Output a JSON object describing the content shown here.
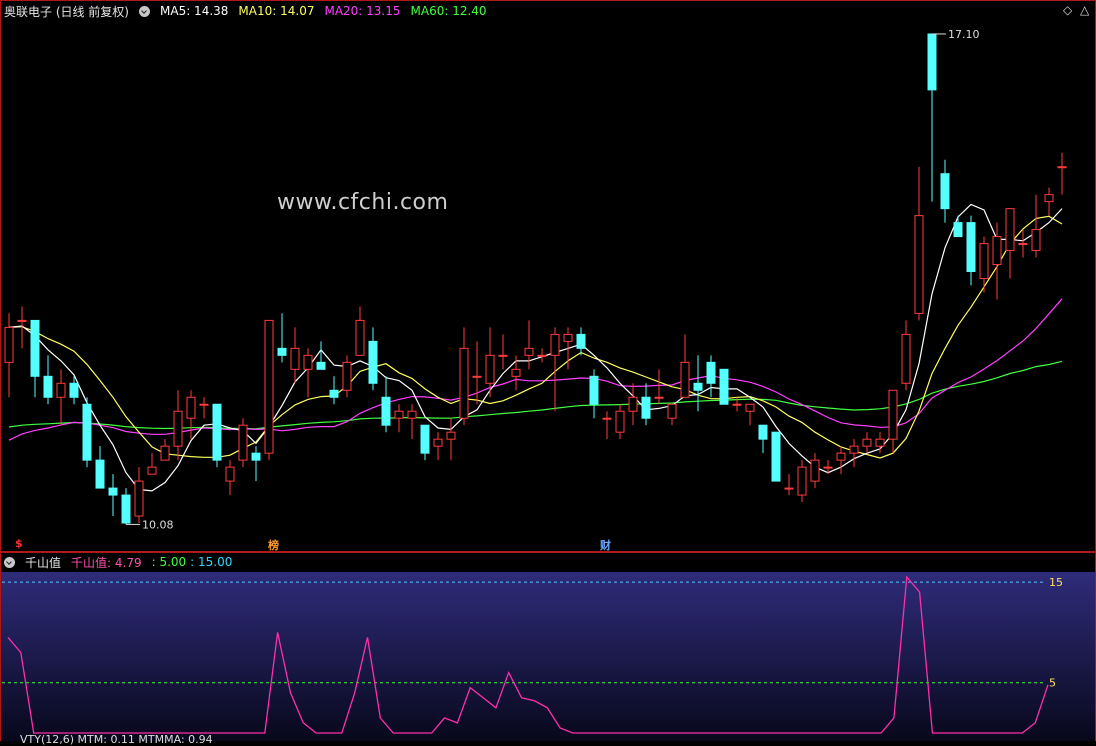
{
  "header": {
    "title": "奥联电子 (日线 前复权)",
    "ma5": "MA5: 14.38",
    "ma10": "MA10: 14.07",
    "ma20": "MA20: 13.15",
    "ma60": "MA60: 12.40",
    "colors": {
      "ma5": "#ffffff",
      "ma10": "#ffff60",
      "ma20": "#ff40ff",
      "ma60": "#40ff40"
    }
  },
  "watermark": "www.cfchi.com",
  "badges": {
    "s_mark": "$",
    "bang": "榜",
    "cai": "财"
  },
  "price_labels": {
    "high": "17.10",
    "low": "10.08"
  },
  "indicator_header": {
    "name": "千山值",
    "value": "千山值: 4.79",
    "level_low": ": 5.00",
    "level_high": ": 15.00"
  },
  "bottom_legend": "VTY(12,6)  MTM: 0.11  MTMMA: 0.94",
  "chart_data": [
    {
      "type": "candlestick",
      "title": "奥联电子 (日线 前复权)",
      "ohlc": [
        [
          12.4,
          13.1,
          11.9,
          12.9
        ],
        [
          13.0,
          13.2,
          12.6,
          13.0
        ],
        [
          13.0,
          13.0,
          11.9,
          12.2
        ],
        [
          12.2,
          12.5,
          11.8,
          11.9
        ],
        [
          11.9,
          12.3,
          11.5,
          12.1
        ],
        [
          12.1,
          12.2,
          11.8,
          11.9
        ],
        [
          11.8,
          11.9,
          10.9,
          11.0
        ],
        [
          11.0,
          11.2,
          10.6,
          10.6
        ],
        [
          10.6,
          10.8,
          10.2,
          10.5
        ],
        [
          10.5,
          10.6,
          10.08,
          10.1
        ],
        [
          10.2,
          10.9,
          10.1,
          10.7
        ],
        [
          10.8,
          11.1,
          10.8,
          10.9
        ],
        [
          11.0,
          11.3,
          11.0,
          11.2
        ],
        [
          11.2,
          12.0,
          11.0,
          11.7
        ],
        [
          11.6,
          12.0,
          11.3,
          11.9
        ],
        [
          11.8,
          11.9,
          11.6,
          11.8
        ],
        [
          11.8,
          11.8,
          10.9,
          11.0
        ],
        [
          10.7,
          11.0,
          10.5,
          10.9
        ],
        [
          11.0,
          11.6,
          10.9,
          11.5
        ],
        [
          11.1,
          11.2,
          10.7,
          11.0
        ],
        [
          11.1,
          13.0,
          11.0,
          13.0
        ],
        [
          12.6,
          13.1,
          12.4,
          12.5
        ],
        [
          12.3,
          12.9,
          12.1,
          12.6
        ],
        [
          12.3,
          12.6,
          11.9,
          12.5
        ],
        [
          12.4,
          12.7,
          12.3,
          12.3
        ],
        [
          12.0,
          12.2,
          11.8,
          11.9
        ],
        [
          12.0,
          12.5,
          11.9,
          12.4
        ],
        [
          12.5,
          13.2,
          12.5,
          13.0
        ],
        [
          12.7,
          12.9,
          12.0,
          12.1
        ],
        [
          11.9,
          12.2,
          11.4,
          11.5
        ],
        [
          11.6,
          11.8,
          11.4,
          11.7
        ],
        [
          11.6,
          11.8,
          11.3,
          11.7
        ],
        [
          11.5,
          11.5,
          11.0,
          11.1
        ],
        [
          11.2,
          11.4,
          11.0,
          11.3
        ],
        [
          11.3,
          11.6,
          11.0,
          11.4
        ],
        [
          11.6,
          12.9,
          11.5,
          12.6
        ],
        [
          12.2,
          12.7,
          11.8,
          12.2
        ],
        [
          12.1,
          12.9,
          11.9,
          12.5
        ],
        [
          12.5,
          12.8,
          12.3,
          12.5
        ],
        [
          12.2,
          12.5,
          12.0,
          12.3
        ],
        [
          12.5,
          13.0,
          12.3,
          12.6
        ],
        [
          12.5,
          12.6,
          12.4,
          12.5
        ],
        [
          12.5,
          12.9,
          11.7,
          12.8
        ],
        [
          12.7,
          12.9,
          12.3,
          12.8
        ],
        [
          12.8,
          12.9,
          12.5,
          12.6
        ],
        [
          12.2,
          12.3,
          11.6,
          11.8
        ],
        [
          11.6,
          11.7,
          11.3,
          11.6
        ],
        [
          11.4,
          11.8,
          11.3,
          11.7
        ],
        [
          11.7,
          12.1,
          11.5,
          11.9
        ],
        [
          11.9,
          12.1,
          11.5,
          11.6
        ],
        [
          11.9,
          12.3,
          11.8,
          11.9
        ],
        [
          11.6,
          11.8,
          11.5,
          11.8
        ],
        [
          11.9,
          12.8,
          11.9,
          12.4
        ],
        [
          12.1,
          12.5,
          11.7,
          12.0
        ],
        [
          12.4,
          12.5,
          11.9,
          12.1
        ],
        [
          12.3,
          12.3,
          11.8,
          11.8
        ],
        [
          11.8,
          11.9,
          11.7,
          11.8
        ],
        [
          11.7,
          11.8,
          11.5,
          11.8
        ],
        [
          11.5,
          11.5,
          11.1,
          11.3
        ],
        [
          11.4,
          11.4,
          10.7,
          10.7
        ],
        [
          10.6,
          10.8,
          10.5,
          10.6
        ],
        [
          10.5,
          11.0,
          10.4,
          10.9
        ],
        [
          10.7,
          11.1,
          10.6,
          11.0
        ],
        [
          10.9,
          11.0,
          10.8,
          10.9
        ],
        [
          11.0,
          11.2,
          10.8,
          11.1
        ],
        [
          11.1,
          11.3,
          10.9,
          11.2
        ],
        [
          11.2,
          11.4,
          11.1,
          11.3
        ],
        [
          11.2,
          11.4,
          11.1,
          11.3
        ],
        [
          11.3,
          12.0,
          11.1,
          12.0
        ],
        [
          12.1,
          13.0,
          12.0,
          12.8
        ],
        [
          13.1,
          15.2,
          13.0,
          14.5
        ],
        [
          17.1,
          17.1,
          14.7,
          16.3
        ],
        [
          15.1,
          15.3,
          14.4,
          14.6
        ],
        [
          14.4,
          14.5,
          14.2,
          14.2
        ],
        [
          14.4,
          14.5,
          13.5,
          13.7
        ],
        [
          13.6,
          14.2,
          13.4,
          14.1
        ],
        [
          13.8,
          14.4,
          13.3,
          14.2
        ],
        [
          14.0,
          14.6,
          13.6,
          14.6
        ],
        [
          14.1,
          14.3,
          13.9,
          14.1
        ],
        [
          14.0,
          14.8,
          13.9,
          14.3
        ],
        [
          14.7,
          14.9,
          14.5,
          14.8
        ],
        [
          15.2,
          15.4,
          14.8,
          15.2
        ]
      ],
      "ma_lines": [
        "MA5",
        "MA10",
        "MA20",
        "MA60"
      ],
      "annotations": {
        "high": 17.1,
        "low": 10.08
      }
    },
    {
      "type": "line",
      "title": "千山值",
      "series": [
        {
          "name": "千山值",
          "values": [
            9.5,
            8.0,
            0,
            0,
            0,
            0,
            0,
            0,
            0,
            0,
            0,
            0,
            0,
            0,
            0,
            0,
            0,
            0,
            0,
            0,
            0,
            10.0,
            4.0,
            1.0,
            0,
            0,
            0,
            4.0,
            9.5,
            1.5,
            0,
            0,
            0,
            0,
            1.5,
            1.0,
            4.5,
            3.5,
            2.5,
            6.0,
            3.5,
            3.2,
            2.5,
            0.5,
            0,
            0,
            0,
            0,
            0,
            0,
            0,
            0,
            0,
            0,
            0,
            0,
            0,
            0,
            0,
            0,
            0,
            0,
            0,
            0,
            0,
            0,
            0,
            0,
            0,
            1.5,
            15.5,
            14.0,
            0,
            0,
            0,
            0,
            0,
            0,
            0,
            0,
            1.0,
            4.79
          ]
        }
      ],
      "reference_levels": [
        5,
        15
      ],
      "ylim": [
        0,
        16
      ]
    }
  ]
}
